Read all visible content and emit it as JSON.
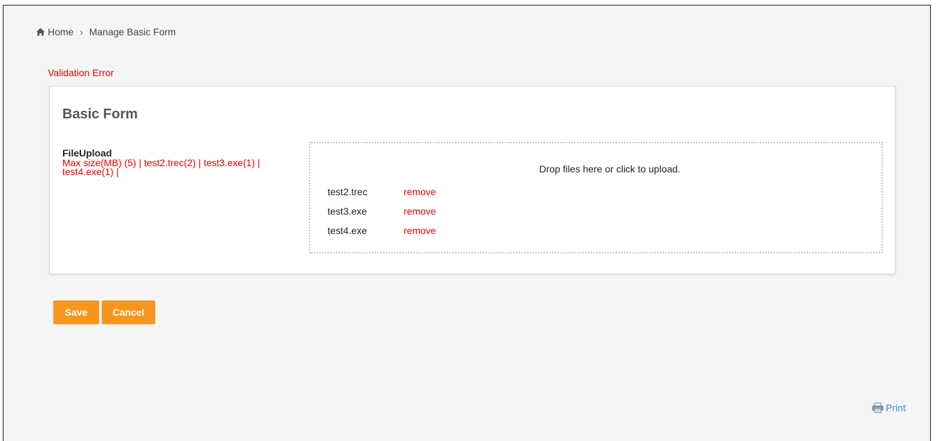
{
  "breadcrumb": {
    "home_label": "Home",
    "separator": "›",
    "current": "Manage Basic Form"
  },
  "validation_message": "Validation Error",
  "form": {
    "title": "Basic Form",
    "field": {
      "label": "FileUpload",
      "error": "Max size(MB) (5) | test2.trec(2) | test3.exe(1) | test4.exe(1) |"
    },
    "dropzone": {
      "message": "Drop files here or click to upload.",
      "files": [
        {
          "name": "test2.trec",
          "action": "remove"
        },
        {
          "name": "test3.exe",
          "action": "remove"
        },
        {
          "name": "test4.exe",
          "action": "remove"
        }
      ]
    }
  },
  "buttons": {
    "save_label": "Save",
    "cancel_label": "Cancel"
  },
  "print_label": "Print",
  "colors": {
    "accent": "#f7961d",
    "error": "#e60000",
    "link": "#3a86c8"
  }
}
